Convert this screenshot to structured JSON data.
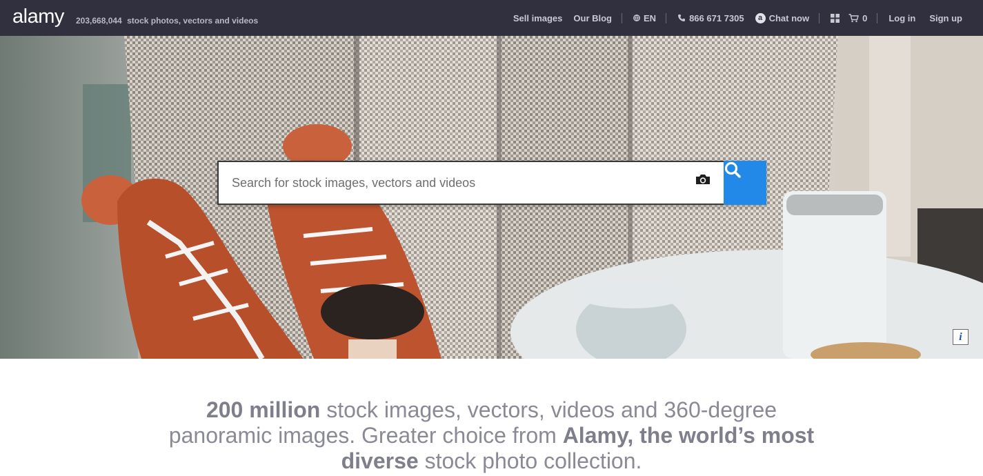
{
  "header": {
    "logo": "alamy",
    "tagline_count": "203,668,044",
    "tagline_text": "stock photos, vectors and videos",
    "nav": {
      "sell_images": "Sell images",
      "our_blog": "Our Blog",
      "language": "EN",
      "phone": "866 671 7305",
      "chat": "Chat now",
      "cart_count": "0",
      "log_in": "Log in",
      "sign_up": "Sign up"
    }
  },
  "hero": {
    "search_placeholder": "Search for stock images, vectors and videos",
    "info_label": "i"
  },
  "intro": {
    "bold1": "200 million",
    "text1": " stock images, vectors, videos and 360-degree panoramic images. Greater choice from ",
    "bold2": "Alamy, the world’s most diverse",
    "text2": " stock photo collection."
  },
  "colors": {
    "topbar": "#30303f",
    "search_button": "#2289e8",
    "intro_text": "#8a8a96"
  },
  "icons": [
    "globe-icon",
    "phone-icon",
    "chat-icon",
    "grid-icon",
    "cart-icon",
    "camera-icon",
    "search-icon",
    "info-icon"
  ]
}
